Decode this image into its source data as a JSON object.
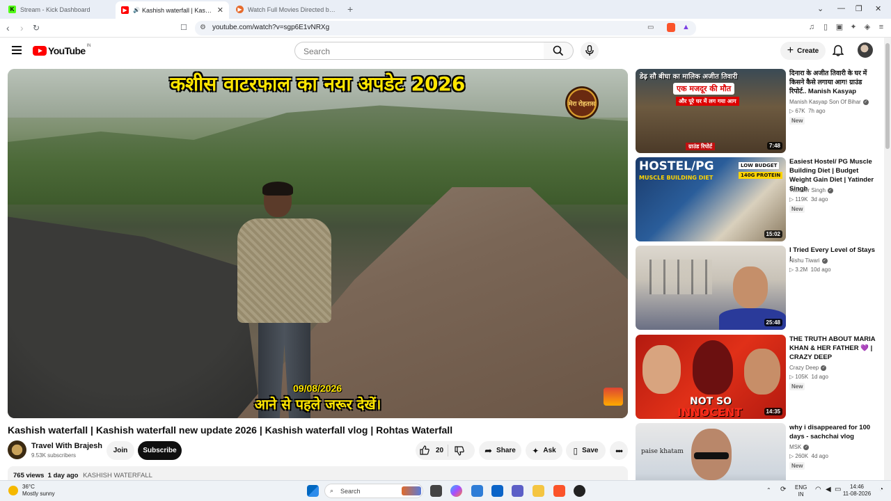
{
  "browser": {
    "tabs": [
      {
        "title": "Stream - Kick Dashboard",
        "icon": "kick-icon",
        "color": "#53fc18"
      },
      {
        "title": "Kashish waterfall | Kashish wa",
        "icon": "youtube-icon",
        "color": "#ff0000",
        "active": true
      },
      {
        "title": "Watch Full Movies Directed by Netfl",
        "icon": "play-icon",
        "color": "#e66a2c"
      }
    ],
    "url": "youtube.com/watch?v=sgp6E1vNRXg"
  },
  "yt_header": {
    "logo_text": "YouTube",
    "country": "IN",
    "search_placeholder": "Search",
    "create_label": "Create"
  },
  "video": {
    "overlay_title": "कशीस वाटरफाल का नया अपडेट 2026",
    "overlay_date": "09/08/2026",
    "overlay_caption": "आने से पहले जरूर देखें।",
    "overlay_logo": "मेरा रोहतास",
    "title": "Kashish waterfall | Kashish waterfall new update 2026 | Kashish waterfall vlog | Rohtas Waterfall",
    "channel": "Travel With Brajesh",
    "subscribers": "9.53K subscribers",
    "join_label": "Join",
    "subscribe_label": "Subscribe",
    "likes": "20",
    "share_label": "Share",
    "ask_label": "Ask",
    "save_label": "Save",
    "views": "765 views",
    "age": "1 day ago",
    "hashtag": "KASHISH WATERFALL"
  },
  "recommendations": [
    {
      "title": "दिनारा के अजीत तिवारी के घर में किसने कैसे लगाया आग! ग्राउंड रिपोर्ट.. Manish Kasyap",
      "channel": "Manish Kasyap Son Of Bihar",
      "views": "67K",
      "age": "7h ago",
      "badge": "New",
      "duration": "7:48",
      "thumb_text": [
        "डेढ़ सौ बीघा का मालिक अजीत तिवारी",
        "एक मजदूर की मौत",
        "और पूरे घर में लग गया आग",
        "ग्राउंड रिपोर्ट"
      ]
    },
    {
      "title": "Easiest Hostel/ PG Muscle Building Diet | Budget Weight Gain Diet | Yatinder Singh",
      "channel": "Yatinder Singh",
      "views": "119K",
      "age": "3d ago",
      "badge": "New",
      "duration": "15:02",
      "thumb_text": [
        "HOSTEL/PG",
        "MUSCLE BUILDING DIET",
        "LOW BUDGET",
        "140G PROTEIN"
      ]
    },
    {
      "title": "I Tried Every Level of Stays !",
      "channel": "Nishu Tiwari",
      "views": "3.2M",
      "age": "10d ago",
      "badge": "",
      "duration": "25:48",
      "thumb_text": []
    },
    {
      "title": "THE TRUTH ABOUT MARIA KHAN & HER FATHER 💜 | CRAZY DEEP",
      "channel": "Crazy Deep",
      "views": "105K",
      "age": "1d ago",
      "badge": "New",
      "duration": "14:35",
      "thumb_text": [
        "NOT SO",
        "INNOCENT"
      ]
    },
    {
      "title": "why i disappeared for 100 days - sachchai vlog",
      "channel": "MSK",
      "views": "260K",
      "age": "4d ago",
      "badge": "New",
      "duration": "",
      "thumb_text": [
        "paise khatam"
      ]
    }
  ],
  "taskbar": {
    "temp": "36°C",
    "weather": "Mostly sunny",
    "search_label": "Search",
    "lang": "ENG",
    "region": "IN",
    "time": "14:46",
    "date": "11-08-2026"
  }
}
